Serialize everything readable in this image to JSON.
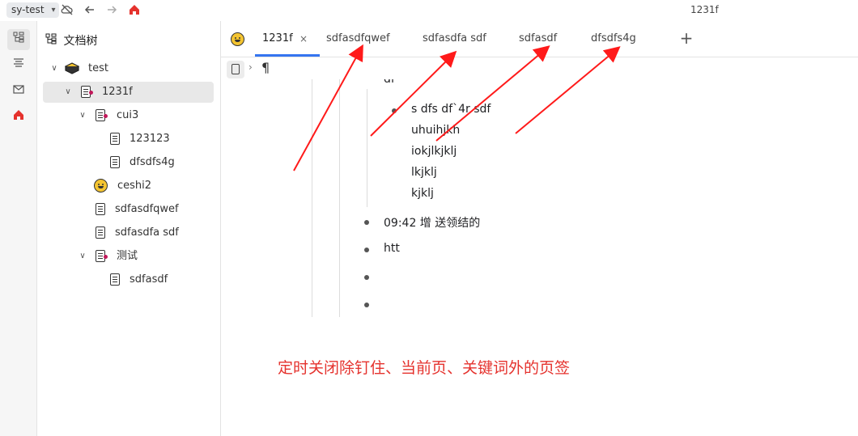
{
  "topbar": {
    "workspace": "sy-test",
    "title": "1231f"
  },
  "sidebar": {
    "title": "文档树",
    "tree": [
      {
        "label": "test"
      },
      {
        "label": "1231f"
      },
      {
        "label": "cui3"
      },
      {
        "label": "123123"
      },
      {
        "label": "dfsdfs4g"
      },
      {
        "label": "ceshi2"
      },
      {
        "label": "sdfasdfqwef"
      },
      {
        "label": "sdfasdfa sdf"
      },
      {
        "label": "测试"
      },
      {
        "label": "sdfasdf"
      }
    ]
  },
  "tabs": [
    {
      "label": "1231f"
    },
    {
      "label": "sdfasdfqwef"
    },
    {
      "label": "sdfasdfa sdf"
    },
    {
      "label": "sdfasdf"
    },
    {
      "label": "dfsdfs4g"
    }
  ],
  "tab_close": "×",
  "tab_add": "+",
  "breadcrumb": {
    "separator": "›",
    "block": "¶"
  },
  "editor": {
    "partial_top": "df",
    "nested": [
      "s dfs df`4r sdf",
      "uhuihjkh",
      "iokjlkjklj",
      "lkjklj",
      "kjklj"
    ],
    "items": [
      "09:42 增 送领结的",
      "htt",
      "",
      ""
    ]
  },
  "annotation": "定时关闭除钉住、当前页、关键词外的页签",
  "colors": {
    "accent": "#3575f0",
    "annotation": "#e5322d",
    "home": "#e5322d"
  }
}
